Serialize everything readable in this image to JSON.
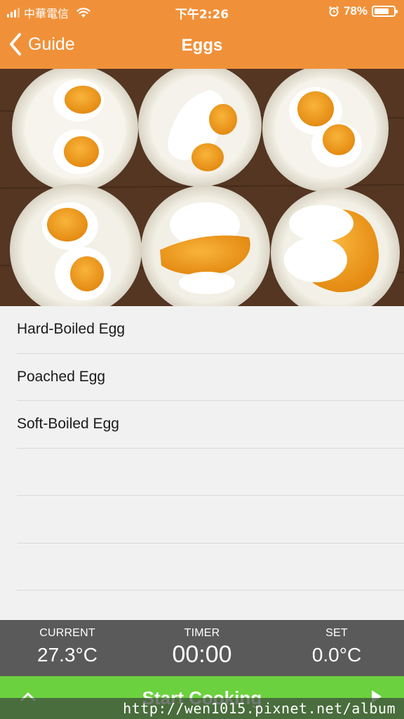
{
  "status_bar": {
    "carrier": "中華電信",
    "time": "下午2:26",
    "battery": "78%",
    "battery_level": 0.78
  },
  "nav": {
    "back_label": "Guide",
    "title": "Eggs"
  },
  "hero": {
    "description": "six bowls of eggs cooked to different doneness"
  },
  "list": {
    "items": [
      {
        "label": "Hard-Boiled Egg"
      },
      {
        "label": "Poached Egg"
      },
      {
        "label": "Soft-Boiled Egg"
      },
      {
        "label": ""
      },
      {
        "label": ""
      },
      {
        "label": ""
      }
    ]
  },
  "panel": {
    "current_label": "CURRENT",
    "current_value": "27.3°C",
    "timer_label": "TIMER",
    "timer_value": "00:00",
    "set_label": "SET",
    "set_value": "0.0°C"
  },
  "cook": {
    "label": "Start Cooking"
  },
  "watermark": "http://wen1015.pixnet.net/album",
  "colors": {
    "header": "#f0913a",
    "panel": "#5a5a5a",
    "cook": "#6cd13f"
  }
}
